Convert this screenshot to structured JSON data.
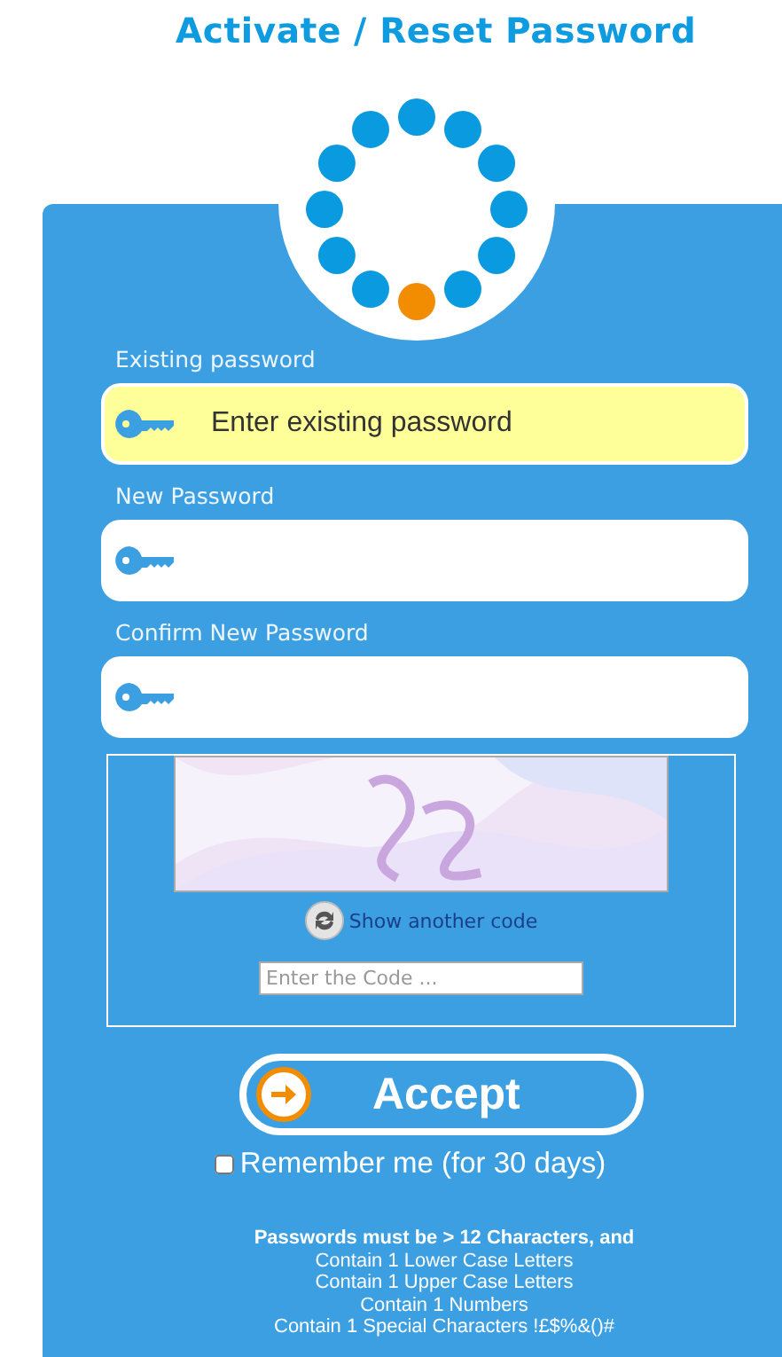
{
  "title": "Activate / Reset Password",
  "spinner": {
    "dots": [
      {
        "color": "#0a9ae0"
      },
      {
        "color": "#0a9ae0"
      },
      {
        "color": "#0a9ae0"
      },
      {
        "color": "#0a9ae0"
      },
      {
        "color": "#0a9ae0"
      },
      {
        "color": "#0a9ae0"
      },
      {
        "color": "#f28c00"
      },
      {
        "color": "#0a9ae0"
      },
      {
        "color": "#0a9ae0"
      },
      {
        "color": "#0a9ae0"
      },
      {
        "color": "#0a9ae0"
      },
      {
        "color": "#0a9ae0"
      }
    ]
  },
  "fields": [
    {
      "label": "Existing password",
      "placeholder": "Enter existing password",
      "focused": true
    },
    {
      "label": "New Password",
      "focused": false
    },
    {
      "label": "Confirm New Password",
      "focused": false
    }
  ],
  "captcha": {
    "refresh_link": "Show another code",
    "code_placeholder": "Enter the Code ..."
  },
  "accept_button": "Accept",
  "remember": {
    "label": "Remember me (for 30 days)",
    "checked": false
  },
  "rules": [
    "Passwords must be > 12 Characters, and",
    "Contain 1 Lower Case Letters",
    "Contain 1 Upper Case Letters",
    "Contain 1 Numbers",
    "Contain 1 Special Characters !£$%&()#"
  ]
}
